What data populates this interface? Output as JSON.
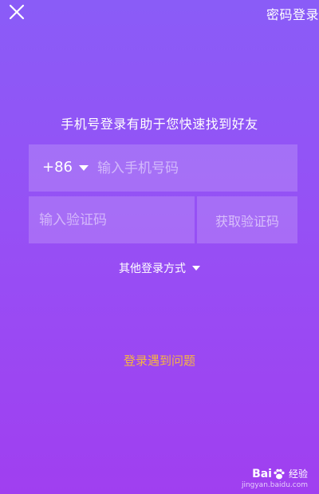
{
  "topbar": {
    "close_icon": "close-icon",
    "password_login_label": "密码登录"
  },
  "subtitle": "手机号登录有助于您快速找到好友",
  "phone": {
    "country_code": "+86",
    "placeholder": "输入手机号码",
    "value": ""
  },
  "code": {
    "placeholder": "输入验证码",
    "value": "",
    "get_code_label": "获取验证码"
  },
  "other_login_label": "其他登录方式",
  "problem_label": "登录遇到问题",
  "watermark": {
    "brand_left": "Bai",
    "brand_right": "经验",
    "url": "jingyan.baidu.com"
  },
  "colors": {
    "background_top": "#8a5cf7",
    "background_bottom": "#a03ff0",
    "accent_link": "#f6b442",
    "text": "#ffffff"
  }
}
